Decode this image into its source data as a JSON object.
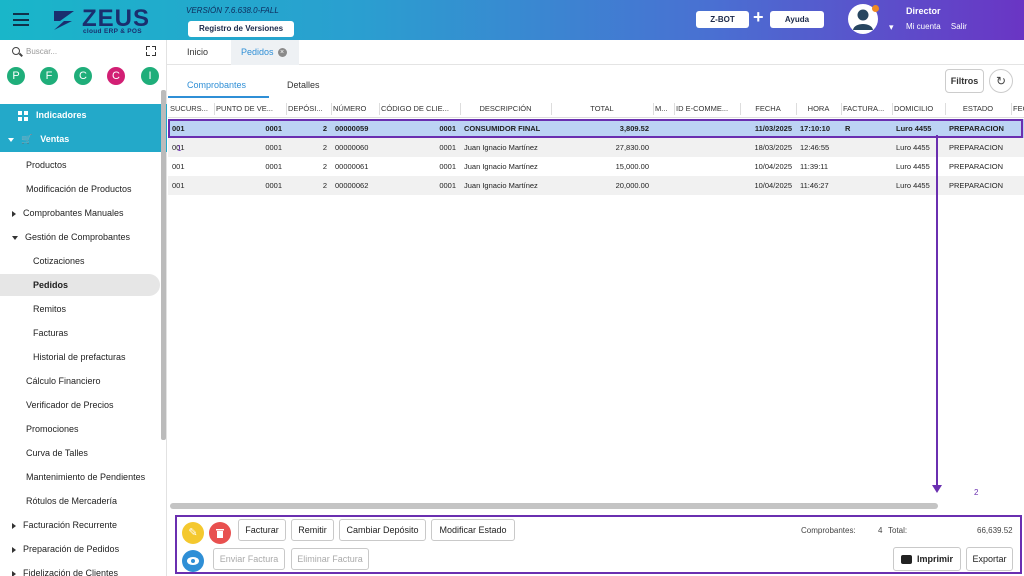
{
  "header": {
    "brand": "ZEUS",
    "brand_sub": "cloud ERP & POS",
    "version": "VERSIÓN 7.6.638.0-FALL",
    "version_button": "Registro de Versiones",
    "zbot_button": "Z-BOT",
    "plus": "+",
    "help_button": "Ayuda",
    "user_name": "Director",
    "account_link": "Mi cuenta",
    "logout_link": "Salir"
  },
  "sidebar": {
    "search_placeholder": "Buscar...",
    "quick_access": [
      {
        "letter": "P",
        "color": "#1fae7a"
      },
      {
        "letter": "F",
        "color": "#1fae7a"
      },
      {
        "letter": "C",
        "color": "#1fae7a"
      },
      {
        "letter": "C",
        "color": "#d21f74"
      },
      {
        "letter": "I",
        "color": "#1fae7a"
      }
    ],
    "indicadores": "Indicadores",
    "ventas": "Ventas",
    "items": [
      {
        "label": "Productos",
        "level": 1,
        "caret": ""
      },
      {
        "label": "Modificación de Productos",
        "level": 1,
        "caret": ""
      },
      {
        "label": "Comprobantes Manuales",
        "level": 1,
        "caret": "right"
      },
      {
        "label": "Gestión de Comprobantes",
        "level": 1,
        "caret": "down"
      },
      {
        "label": "Cotizaciones",
        "level": 2,
        "caret": ""
      },
      {
        "label": "Pedidos",
        "level": 2,
        "caret": "",
        "selected": true
      },
      {
        "label": "Remitos",
        "level": 2,
        "caret": ""
      },
      {
        "label": "Facturas",
        "level": 2,
        "caret": ""
      },
      {
        "label": "Historial de prefacturas",
        "level": 2,
        "caret": ""
      },
      {
        "label": "Cálculo Financiero",
        "level": 1,
        "caret": ""
      },
      {
        "label": "Verificador de Precios",
        "level": 1,
        "caret": ""
      },
      {
        "label": "Promociones",
        "level": 1,
        "caret": ""
      },
      {
        "label": "Curva de Talles",
        "level": 1,
        "caret": ""
      },
      {
        "label": "Mantenimiento de Pendientes",
        "level": 1,
        "caret": ""
      },
      {
        "label": "Rótulos de Mercadería",
        "level": 1,
        "caret": ""
      },
      {
        "label": "Facturación Recurrente",
        "level": 1,
        "caret": "right"
      },
      {
        "label": "Preparación de Pedidos",
        "level": 1,
        "caret": "right"
      },
      {
        "label": "Fidelización de Clientes",
        "level": 1,
        "caret": "right"
      }
    ]
  },
  "tabs": {
    "home": "Inicio",
    "active": "Pedidos"
  },
  "subtabs": {
    "comprobantes": "Comprobantes",
    "detalles": "Detalles"
  },
  "actions": {
    "filters": "Filtros"
  },
  "grid": {
    "columns": [
      "SUCURS...",
      "PUNTO DE VE...",
      "DEPÓSI...",
      "NÚMERO",
      "CÓDIGO DE CLIE...",
      "DESCRIPCIÓN",
      "TOTAL",
      "M...",
      "ID E-COMME...",
      "FECHA",
      "HORA",
      "FACTURA...",
      "DOMICILIO",
      "ESTADO",
      "FEC"
    ],
    "rows": [
      [
        "001",
        "0001",
        "2",
        "00000059",
        "0001",
        "CONSUMIDOR FINAL",
        "3,809.52",
        "",
        "",
        "11/03/2025",
        "17:10:10",
        "R",
        "Luro 4455",
        "PREPARACION"
      ],
      [
        "001",
        "0001",
        "2",
        "00000060",
        "0001",
        "Juan Ignacio Martínez",
        "27,830.00",
        "",
        "",
        "18/03/2025",
        "12:46:55",
        "",
        "Luro 4455",
        "PREPARACION"
      ],
      [
        "001",
        "0001",
        "2",
        "00000061",
        "0001",
        "Juan Ignacio Martínez",
        "15,000.00",
        "",
        "",
        "10/04/2025",
        "11:39:11",
        "",
        "Luro 4455",
        "PREPARACION"
      ],
      [
        "001",
        "0001",
        "2",
        "00000062",
        "0001",
        "Juan Ignacio Martínez",
        "20,000.00",
        "",
        "",
        "10/04/2025",
        "11:46:27",
        "",
        "Luro 4455",
        "PREPARACION"
      ]
    ]
  },
  "annotations": {
    "row_marker": "1",
    "column_marker": "2"
  },
  "toolbar": {
    "facturar": "Facturar",
    "remitir": "Remitir",
    "cambiar_deposito": "Cambiar Depósito",
    "modificar_estado": "Modificar Estado",
    "enviar_factura": "Enviar Factura",
    "eliminar_factura": "Eliminar Factura",
    "imprimir": "Imprimir",
    "exportar": "Exportar",
    "comprobantes_label": "Comprobantes:",
    "comprobantes_count": "4",
    "total_label": "Total:",
    "total_value": "66,639.52"
  },
  "colors": {
    "accent": "#2f8fd6",
    "sidebar_highlight": "#23a9c9",
    "annotation": "#6a2fb0",
    "edit": "#f4c82e",
    "delete": "#e8504f",
    "view": "#2f8fd6"
  }
}
